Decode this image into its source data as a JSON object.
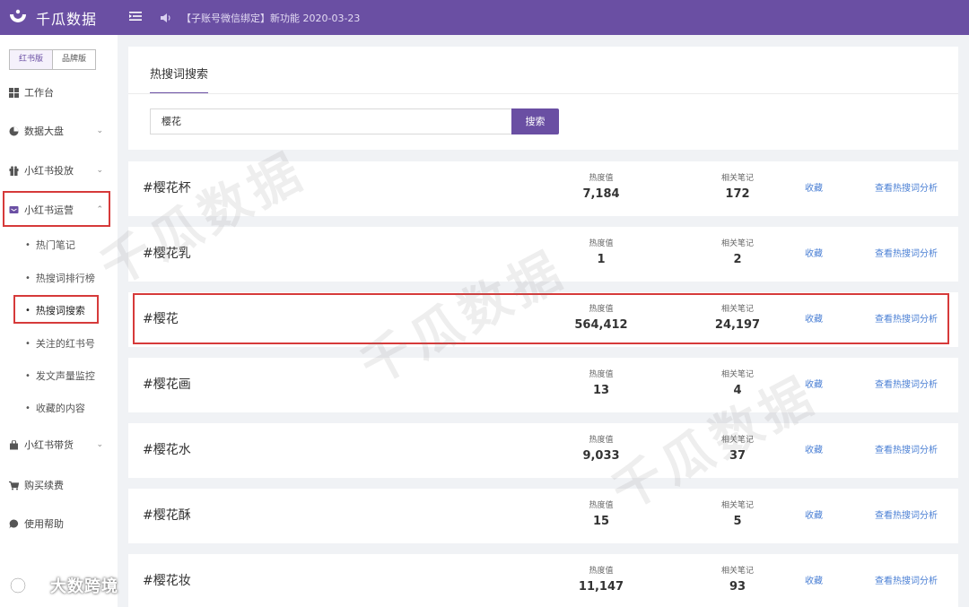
{
  "topbar": {
    "brand": "千瓜数据",
    "notice": "【子账号微信绑定】新功能  2020-03-23"
  },
  "sidebar": {
    "versions": [
      "红书版",
      "品牌版"
    ],
    "items": [
      {
        "label": "工作台",
        "icon": "grid-icon"
      },
      {
        "label": "数据大盘",
        "icon": "pie-chart-icon"
      },
      {
        "label": "小红书投放",
        "icon": "gift-icon"
      },
      {
        "label": "小红书运营",
        "icon": "message-icon"
      },
      {
        "label": "小红书带货",
        "icon": "bag-icon"
      },
      {
        "label": "购买续费",
        "icon": "cart-icon"
      },
      {
        "label": "使用帮助",
        "icon": "help-icon"
      }
    ],
    "sub_items": [
      "热门笔记",
      "热搜词排行榜",
      "热搜词搜索",
      "关注的红书号",
      "发文声量监控",
      "收藏的内容"
    ]
  },
  "main": {
    "tab": "热搜词搜索",
    "search_value": "樱花",
    "search_button": "搜索",
    "heat_label": "热度值",
    "notes_label": "相关笔记",
    "fav_label": "收藏",
    "analysis_label": "查看热搜词分析",
    "rows": [
      {
        "keyword": "#樱花杯",
        "heat": "7,184",
        "notes": "172"
      },
      {
        "keyword": "#樱花乳",
        "heat": "1",
        "notes": "2"
      },
      {
        "keyword": "#樱花",
        "heat": "564,412",
        "notes": "24,197"
      },
      {
        "keyword": "#樱花画",
        "heat": "13",
        "notes": "4"
      },
      {
        "keyword": "#樱花水",
        "heat": "9,033",
        "notes": "37"
      },
      {
        "keyword": "#樱花酥",
        "heat": "15",
        "notes": "5"
      },
      {
        "keyword": "#樱花妆",
        "heat": "11,147",
        "notes": "93"
      }
    ]
  },
  "watermark": "千瓜数据",
  "corner_brand": "大数跨境",
  "colors": {
    "brand": "#6a4fa3",
    "link": "#4a7fd4",
    "highlight": "#d63a3a"
  }
}
